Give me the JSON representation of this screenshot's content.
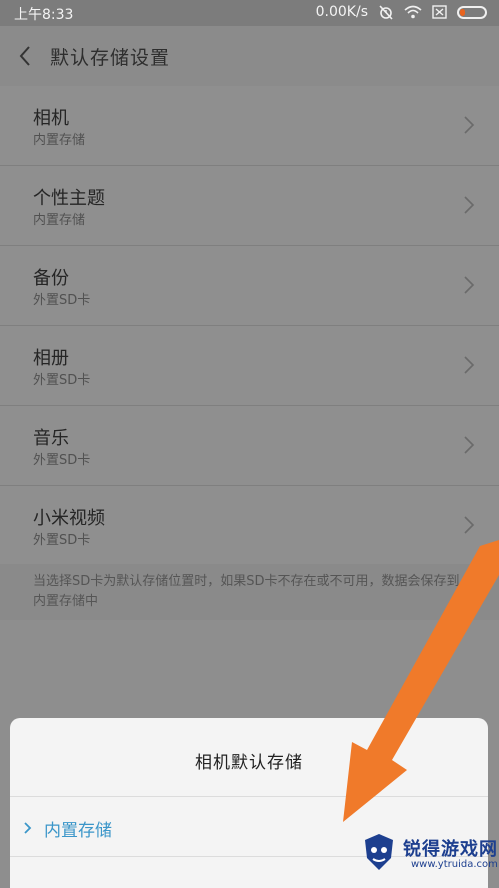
{
  "status_bar": {
    "time": "上午8:33",
    "speed": "0.00K/s",
    "icons": [
      "alarm-muted-icon",
      "wifi-icon",
      "sim-error-icon",
      "battery-icon"
    ],
    "battery_level": 0.2
  },
  "header": {
    "back_icon": "chevron-left-icon",
    "title": "默认存储设置"
  },
  "settings": {
    "items": [
      {
        "title": "相机",
        "subtitle": "内置存储"
      },
      {
        "title": "个性主题",
        "subtitle": "内置存储"
      },
      {
        "title": "备份",
        "subtitle": "外置SD卡"
      },
      {
        "title": "相册",
        "subtitle": "外置SD卡"
      },
      {
        "title": "音乐",
        "subtitle": "外置SD卡"
      },
      {
        "title": "小米视频",
        "subtitle": "外置SD卡"
      }
    ],
    "note": "当选择SD卡为默认存储位置时，如果SD卡不存在或不可用，数据会保存到内置存储中"
  },
  "sheet": {
    "title": "相机默认存储",
    "option_selected": "内置存储"
  },
  "watermark": {
    "name": "锐得游戏网",
    "url": "www.ytruida.com"
  },
  "colors": {
    "accent": "#3b96c9",
    "annotation_arrow": "#f07a2a",
    "watermark": "#1d3f8f"
  }
}
